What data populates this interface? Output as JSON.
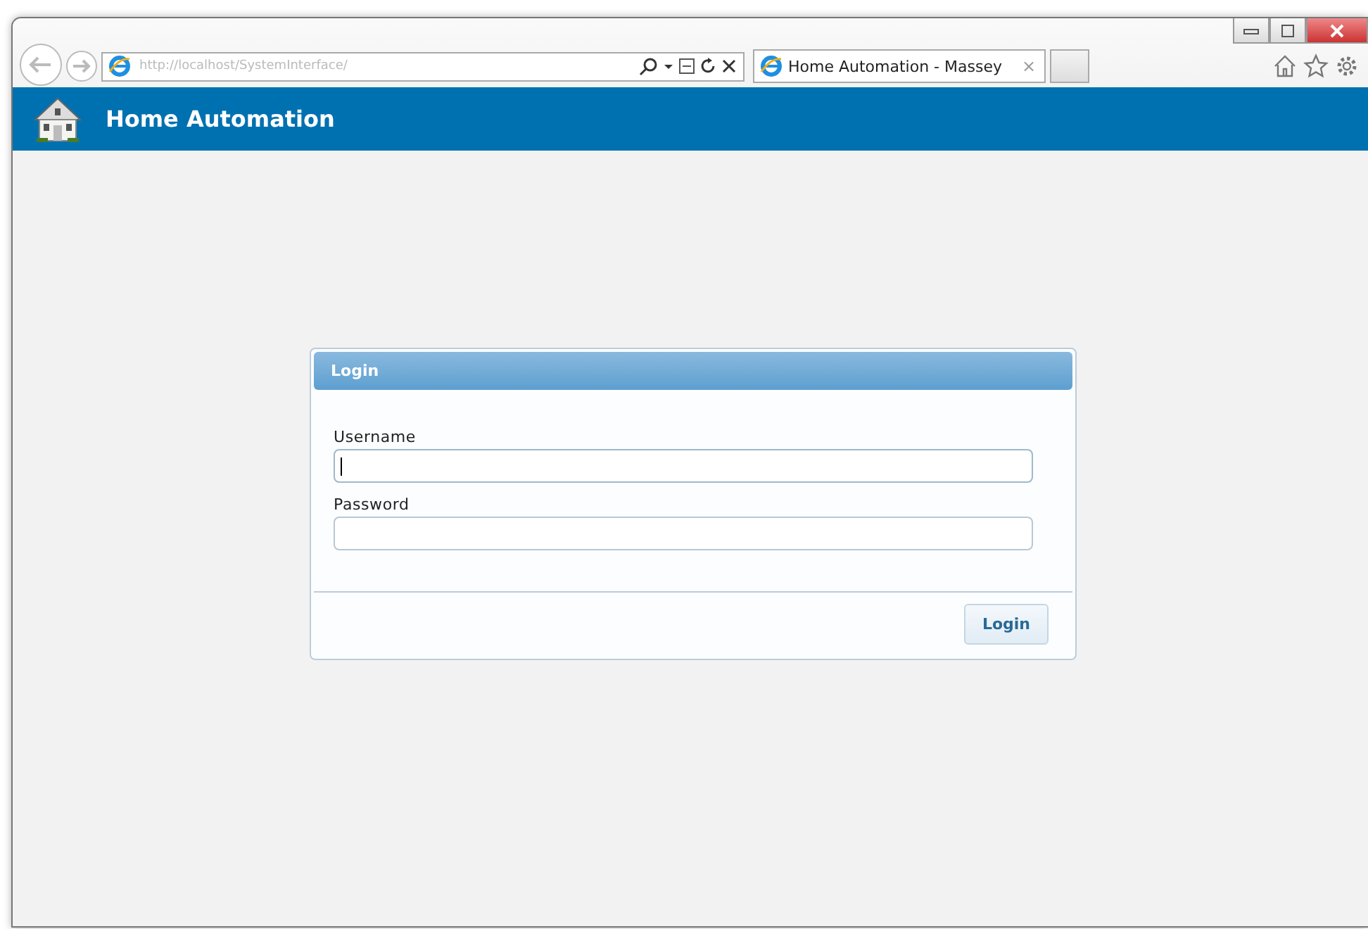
{
  "browser": {
    "address": "http://localhost/SystemInterface/",
    "tabs": [
      {
        "title": "Home Automation - Massey",
        "close": "×",
        "selected": true
      }
    ]
  },
  "header": {
    "title": "Home Automation"
  },
  "login": {
    "title": "Login",
    "fields": [
      {
        "label": "Username",
        "focused": true
      },
      {
        "label": "Password",
        "focused": false
      }
    ],
    "button": "Login"
  }
}
